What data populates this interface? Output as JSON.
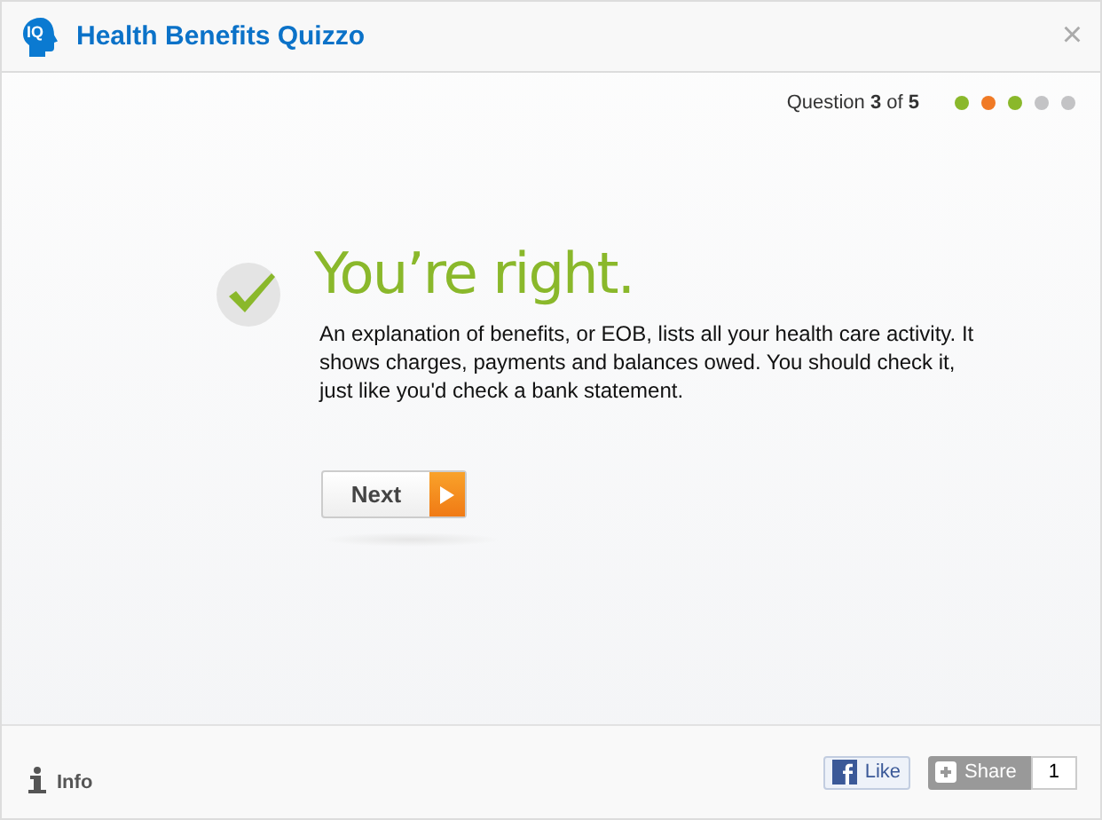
{
  "header": {
    "logo_text": "IQ",
    "title": "Health Benefits Quizzo",
    "close": "×"
  },
  "progress": {
    "label": "Question **3** of **5**",
    "dots": [
      {
        "color": "#8ab82b"
      },
      {
        "color": "#f07a25"
      },
      {
        "color": "#8ab82b"
      },
      {
        "color": "#c3c3c5"
      },
      {
        "color": "#c3c3c5"
      }
    ]
  },
  "result": {
    "correct": true,
    "heading": "You’re right.",
    "explanation": "An explanation of benefits, or EOB, lists all your health care activity. It shows charges, payments and balances owed. You should check it, just like you'd check a bank statement."
  },
  "next_button": "Next",
  "footer": {
    "info": "Info",
    "like": "Like",
    "share": "Share",
    "share_count": "1"
  }
}
